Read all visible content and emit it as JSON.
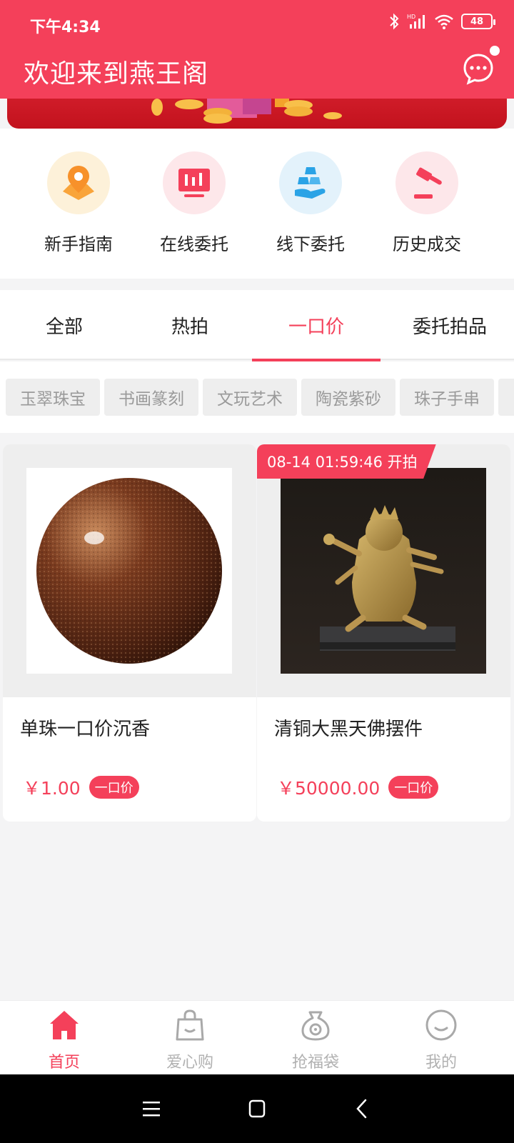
{
  "status_bar": {
    "time": "下午4:34",
    "battery": "48"
  },
  "header": {
    "title": "欢迎来到燕王阁",
    "message_icon": "chat-bubble-icon"
  },
  "quick_menu": [
    {
      "label": "新手指南",
      "icon": "map-pin-icon",
      "color": "#f9a43a",
      "bg": "#fdf1d9"
    },
    {
      "label": "在线委托",
      "icon": "monitor-chart-icon",
      "color": "#f4405a",
      "bg": "#fde7ea"
    },
    {
      "label": "线下委托",
      "icon": "gold-bars-icon",
      "color": "#2aa3e6",
      "bg": "#e3f2fb"
    },
    {
      "label": "历史成交",
      "icon": "gavel-icon",
      "color": "#f4405a",
      "bg": "#fde7ea"
    }
  ],
  "tabs": [
    {
      "label": "全部",
      "active": false
    },
    {
      "label": "热拍",
      "active": false
    },
    {
      "label": "一口价",
      "active": true
    },
    {
      "label": "委托拍品",
      "active": false
    }
  ],
  "categories": [
    "玉翠珠宝",
    "书画篆刻",
    "文玩艺术",
    "陶瓷紫砂",
    "珠子手串"
  ],
  "products": [
    {
      "name": "单珠一口价沉香",
      "price": "￥1.00",
      "tag": "一口价",
      "badge": ""
    },
    {
      "name": "清铜大黑天佛摆件",
      "price": "￥50000.00",
      "tag": "一口价",
      "badge": "08-14 01:59:46 开拍"
    }
  ],
  "bottom_nav": [
    {
      "label": "首页",
      "icon": "home-icon",
      "active": true
    },
    {
      "label": "爱心购",
      "icon": "shopping-bag-icon",
      "active": false
    },
    {
      "label": "抢福袋",
      "icon": "lucky-bag-icon",
      "active": false
    },
    {
      "label": "我的",
      "icon": "smiley-profile-icon",
      "active": false
    }
  ],
  "colors": {
    "accent": "#f4405a",
    "background": "#f4f4f5"
  }
}
